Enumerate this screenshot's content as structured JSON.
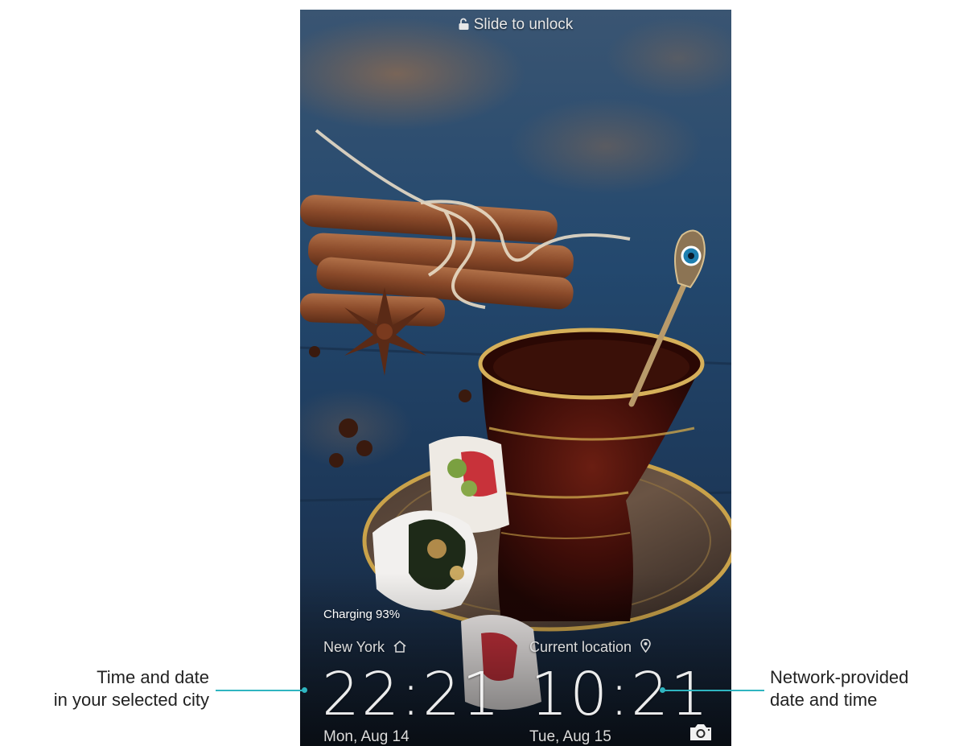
{
  "lock_screen": {
    "unlock_hint": "Slide to unlock",
    "charging_status": "Charging 93%",
    "home_clock": {
      "city": "New York",
      "time": "22:21",
      "date": "Mon, Aug 14"
    },
    "local_clock": {
      "city": "Current location",
      "time": "10:21",
      "date": "Tue, Aug 15"
    },
    "icons": {
      "unlock": "padlock-open-icon",
      "home": "home-icon",
      "location": "location-pin-icon",
      "camera": "camera-icon"
    }
  },
  "annotations": {
    "left": [
      "Time and date",
      "in your selected city"
    ],
    "right": [
      "Network-provided",
      "date and time"
    ]
  },
  "colors": {
    "leader_line": "#2fb5c0",
    "clock_text": "#ffffff"
  }
}
